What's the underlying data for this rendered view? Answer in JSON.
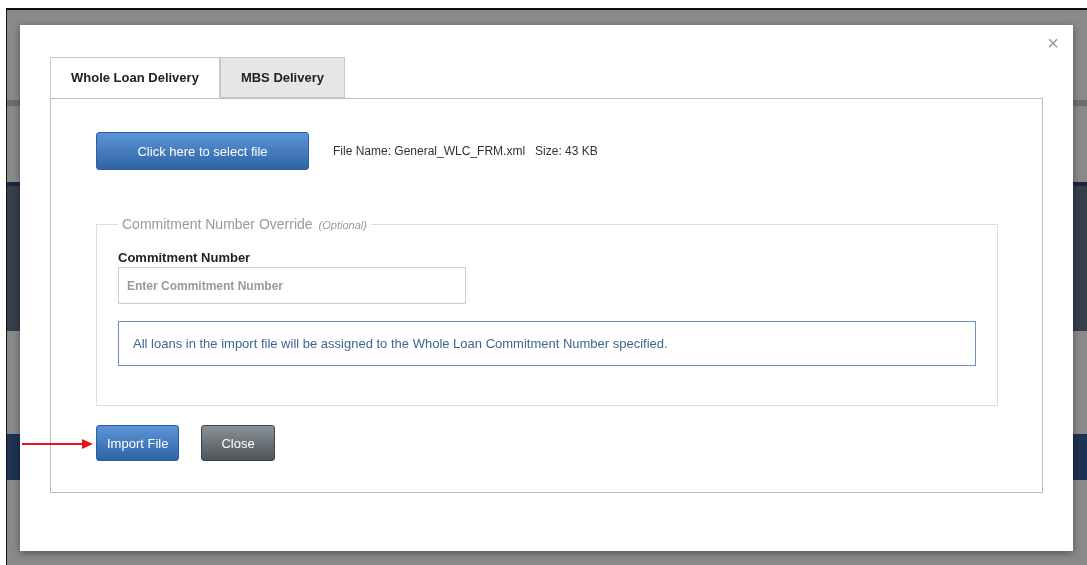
{
  "modal": {
    "close": "×",
    "tabs": [
      {
        "label": "Whole Loan Delivery",
        "selected": true
      },
      {
        "label": "MBS Delivery",
        "selected": false
      }
    ],
    "select_button": "Click here to select file",
    "file_name": "File Name: General_WLC_FRM.xml",
    "file_size": "Size: 43 KB",
    "fieldset": {
      "legend": "Commitment Number Override",
      "legend_note": "(Optional)",
      "field_label": "Commitment Number",
      "placeholder": "Enter Commitment Number",
      "info": "All loans in the import file will be assigned to the Whole Loan Commitment Number specified."
    },
    "buttons": [
      {
        "label": "Import File",
        "kind": "primary"
      },
      {
        "label": "Close",
        "kind": "secondary"
      }
    ]
  }
}
